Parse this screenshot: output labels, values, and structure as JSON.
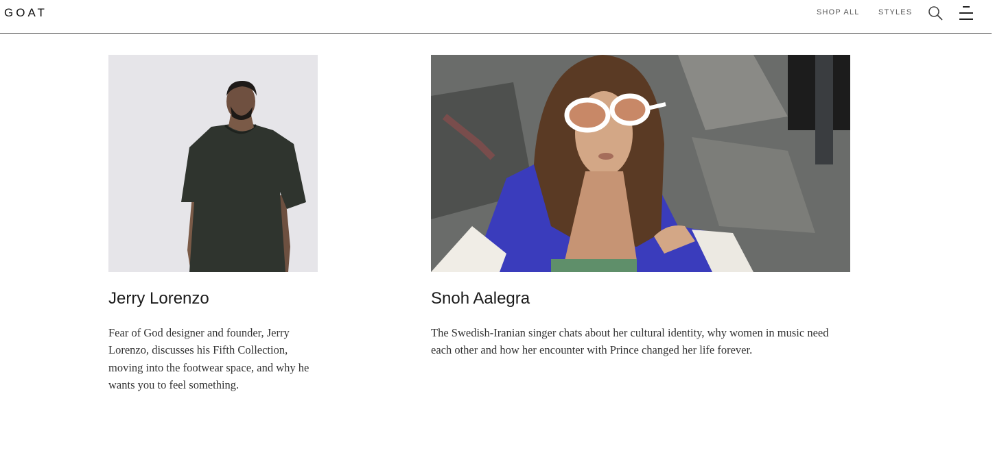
{
  "header": {
    "logo": "GOAT",
    "nav": [
      {
        "label": "SHOP ALL"
      },
      {
        "label": "STYLES"
      }
    ],
    "icons": [
      "search-icon",
      "menu-icon"
    ]
  },
  "articles": [
    {
      "title": "Jerry Lorenzo",
      "description": "Fear of God designer and founder, Jerry Lorenzo, discusses his Fifth Collection, moving into the footwear space, and why he wants you to feel something."
    },
    {
      "title": "Snoh Aalegra",
      "description": "The Swedish-Iranian singer chats about her cultural identity, why women in music need each other and how her encounter with Prince changed her life forever."
    }
  ]
}
